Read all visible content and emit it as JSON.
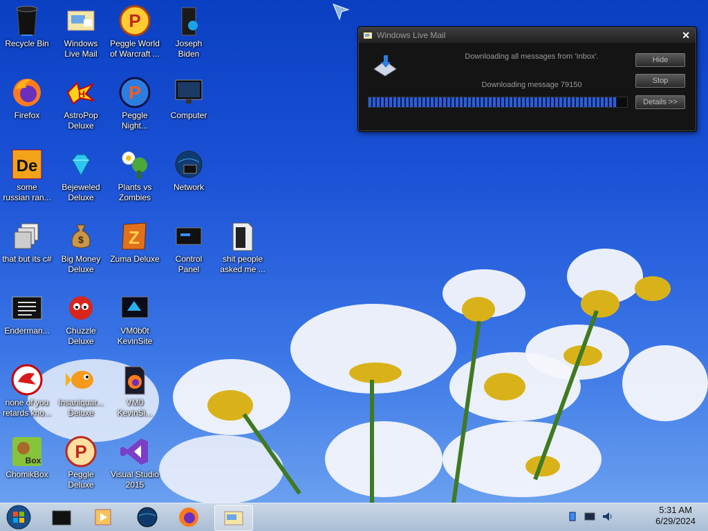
{
  "desktop": {
    "icons": [
      {
        "label": "Recycle Bin",
        "icon": "recycle-bin-icon"
      },
      {
        "label": "Windows\nLive Mail",
        "icon": "windows-live-mail-icon"
      },
      {
        "label": "Peggle World\nof Warcraft ...",
        "icon": "peggle-icon"
      },
      {
        "label": "Joseph\nBiden",
        "icon": "computer-tower-icon"
      },
      {
        "label": "Firefox",
        "icon": "firefox-icon"
      },
      {
        "label": "AstroPop\nDeluxe",
        "icon": "astropop-icon"
      },
      {
        "label": "Peggle\nNight...",
        "icon": "peggle-night-icon"
      },
      {
        "label": "Computer",
        "icon": "monitor-icon"
      },
      {
        "label": "some\nrussian ran...",
        "icon": "de-icon"
      },
      {
        "label": "Bejeweled\nDeluxe",
        "icon": "gem-icon"
      },
      {
        "label": "Plants vs\nZombies",
        "icon": "plants-icon"
      },
      {
        "label": "Network",
        "icon": "network-globe-icon"
      },
      {
        "label": "that but its c#",
        "icon": "windows-stack-icon"
      },
      {
        "label": "Big Money\nDeluxe",
        "icon": "money-bag-icon"
      },
      {
        "label": "Zuma Deluxe",
        "icon": "zuma-icon"
      },
      {
        "label": "Control\nPanel",
        "icon": "control-panel-icon"
      },
      {
        "label": "shit people\nasked me ...",
        "icon": "folder-icon"
      },
      {
        "label": "Enderman...",
        "icon": "console-icon"
      },
      {
        "label": "Chuzzle\nDeluxe",
        "icon": "chuzzle-icon"
      },
      {
        "label": "VM0b0t\nKevinSite",
        "icon": "kevinsite-icon"
      },
      {
        "label": "none of you\nretards kno...",
        "icon": "red-dragon-icon"
      },
      {
        "label": "Insaniquar...\nDeluxe",
        "icon": "fish-icon"
      },
      {
        "label": "VM0\nKevinSi...",
        "icon": "firefox-file-icon"
      },
      {
        "label": "ChomikBox",
        "icon": "hamster-box-icon"
      },
      {
        "label": "Peggle\nDeluxe",
        "icon": "peggle-deluxe-icon"
      },
      {
        "label": "Visual Studio\n2015",
        "icon": "visual-studio-icon"
      }
    ]
  },
  "wlm": {
    "title": "Windows Live Mail",
    "close": "✕",
    "msg1": "Downloading all messages from 'Inbox'.",
    "msg2": "Downloading message 79150",
    "progress_fraction": 0.96,
    "buttons": {
      "hide": "Hide",
      "stop": "Stop",
      "details": "Details >>"
    }
  },
  "taskbar": {
    "clock_time": "5:31 AM",
    "clock_date": "6/29/2024",
    "items": [
      "start-orb-icon",
      "black-box-icon",
      "media-player-icon",
      "globe-icon",
      "firefox-icon",
      "windows-live-mail-icon"
    ]
  }
}
